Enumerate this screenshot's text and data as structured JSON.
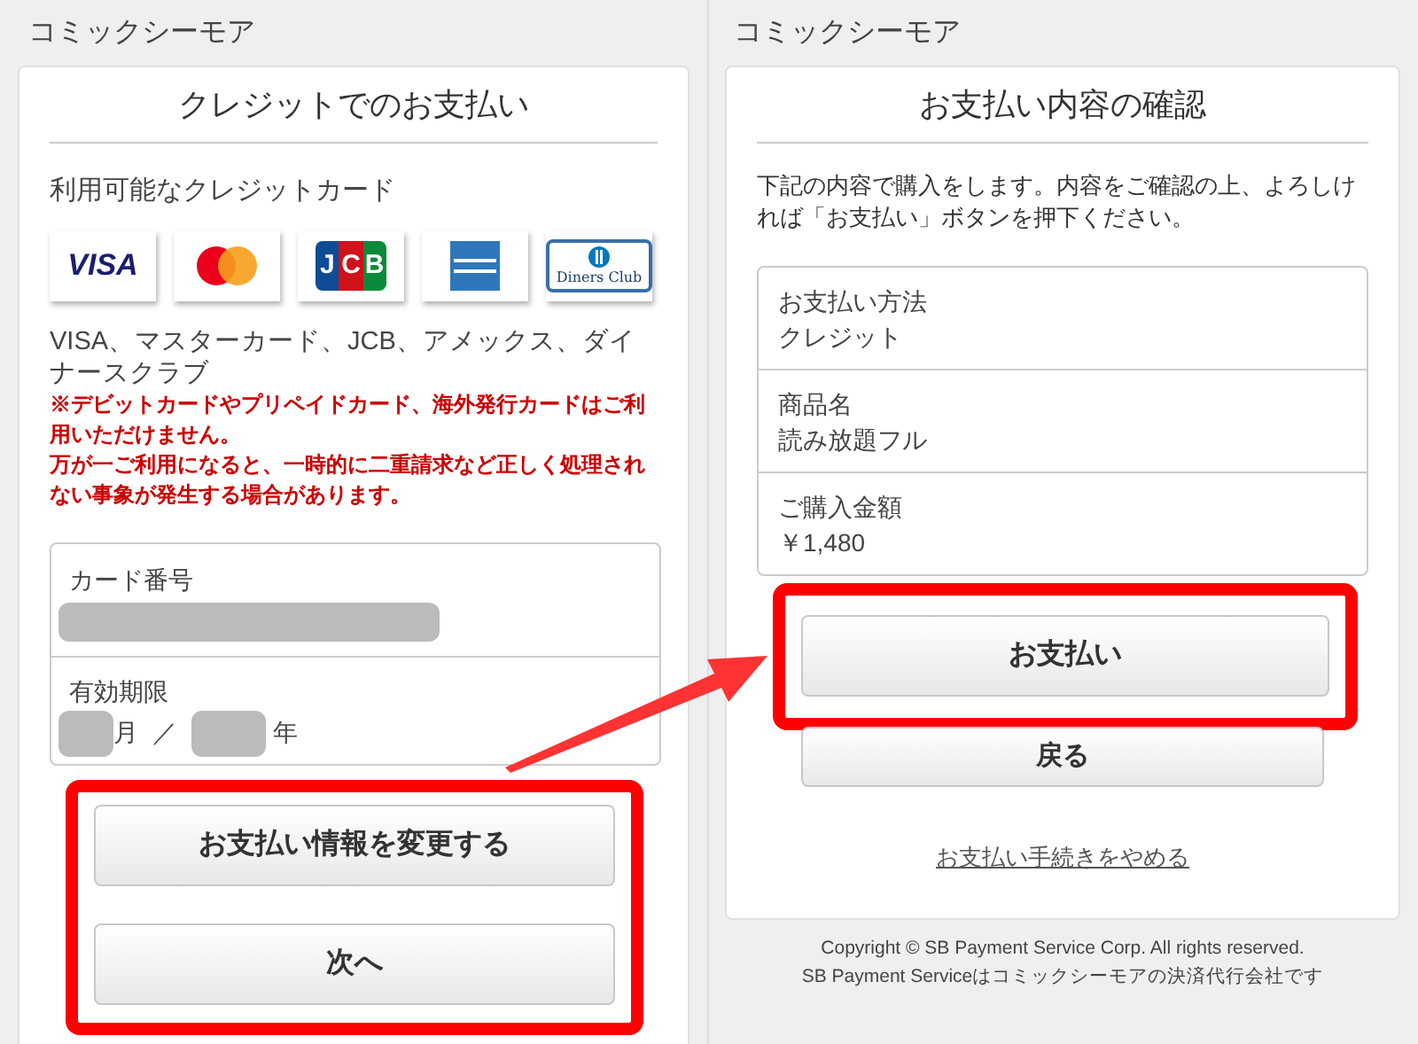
{
  "left": {
    "site_name": "コミックシーモア",
    "title": "クレジットでのお支払い",
    "cards_heading": "利用可能なクレジットカード",
    "card_logos": [
      {
        "kind": "visa",
        "label": "VISA"
      },
      {
        "kind": "mastercard"
      },
      {
        "kind": "jcb",
        "label": "JCB"
      },
      {
        "kind": "amex"
      },
      {
        "kind": "diners",
        "label": "Diners Club"
      }
    ],
    "cards_text": "VISA、マスターカード、JCB、アメックス、ダイナースクラブ",
    "warnings": [
      "※デビットカードやプリペイドカード、海外発行カードはご利用いただけません。",
      "万が一ご利用になると、一時的に二重請求など正しく処理されない事象が発生する場合があります。"
    ],
    "card_number_label": "カード番号",
    "expiry_label": "有効期限",
    "month_unit": "月",
    "separator": "／",
    "year_unit": "年",
    "buttons": [
      "お支払い情報を変更する",
      "次へ"
    ]
  },
  "right": {
    "site_name": "コミックシーモア",
    "title": "お支払い内容の確認",
    "description": "下記の内容で購入をします。内容をご確認の上、よろしければ「お支払い」ボタンを押下ください。",
    "details": [
      {
        "label": "お支払い方法",
        "value": "クレジット"
      },
      {
        "label": "商品名",
        "value": "読み放題フル"
      },
      {
        "label": "ご購入金額",
        "value": "￥1,480"
      }
    ],
    "pay_button": "お支払い",
    "back_button": "戻る",
    "cancel_link": "お支払い手続きをやめる",
    "footer": [
      "Copyright © SB Payment Service Corp. All rights reserved.",
      "SB Payment Serviceはコミックシーモアの決済代行会社です"
    ]
  }
}
